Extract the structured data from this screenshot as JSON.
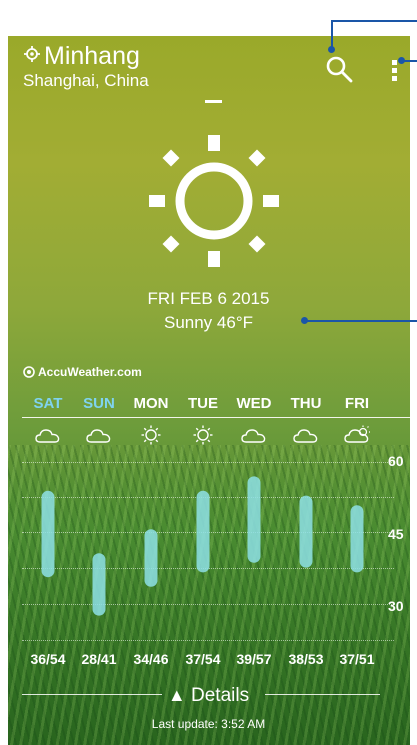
{
  "location": {
    "city": "Minhang",
    "region": "Shanghai, China"
  },
  "current": {
    "date": "FRI FEB 6 2015",
    "condition": "Sunny 46°F",
    "icon": "sun-icon"
  },
  "brand": "AccuWeather.com",
  "forecast": [
    {
      "day": "SAT",
      "icon": "cloud-icon",
      "range": "36/54",
      "low": 36,
      "high": 54,
      "highlight": true
    },
    {
      "day": "SUN",
      "icon": "cloud-icon",
      "range": "28/41",
      "low": 28,
      "high": 41,
      "highlight": true
    },
    {
      "day": "MON",
      "icon": "sun-icon",
      "range": "34/46",
      "low": 34,
      "high": 46,
      "highlight": false
    },
    {
      "day": "TUE",
      "icon": "sun-icon",
      "range": "37/54",
      "low": 37,
      "high": 54,
      "highlight": false
    },
    {
      "day": "WED",
      "icon": "cloud-icon",
      "range": "39/57",
      "low": 39,
      "high": 57,
      "highlight": false
    },
    {
      "day": "THU",
      "icon": "cloud-icon",
      "range": "38/53",
      "low": 38,
      "high": 53,
      "highlight": false
    },
    {
      "day": "FRI",
      "icon": "partly-cloudy-icon",
      "range": "37/51",
      "low": 37,
      "high": 51,
      "highlight": false
    }
  ],
  "chart_data": {
    "type": "bar",
    "categories": [
      "SAT",
      "SUN",
      "MON",
      "TUE",
      "WED",
      "THU",
      "FRI"
    ],
    "series": [
      {
        "values_low": [
          36,
          28,
          34,
          37,
          39,
          38,
          37
        ],
        "values_high": [
          54,
          41,
          46,
          54,
          57,
          53,
          51
        ]
      }
    ],
    "ytick_labels": [
      "60",
      "45",
      "30"
    ],
    "yticks": [
      60,
      45,
      30
    ],
    "ylim": [
      25,
      65
    ],
    "grid": true,
    "bar_color": "#8ee0e6"
  },
  "details_label": "Details",
  "last_update": "Last update: 3:52 AM",
  "colors": {
    "accent": "#7fd3f0",
    "callout": "#1a56a8"
  }
}
